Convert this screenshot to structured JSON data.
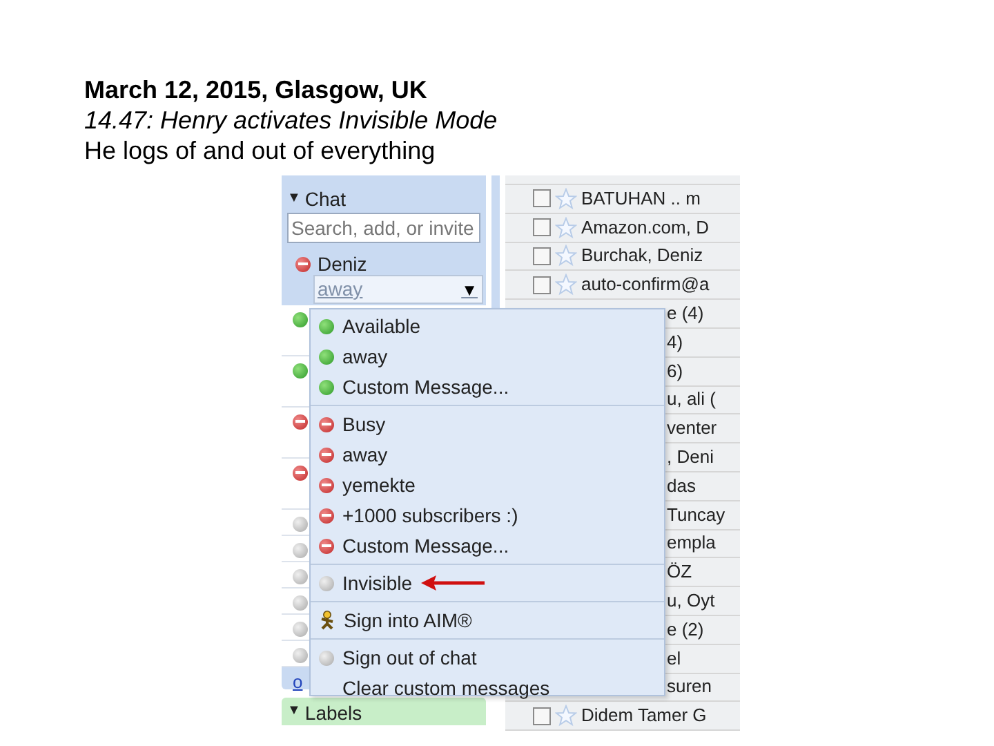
{
  "caption": {
    "heading": "March 12, 2015, Glasgow, UK",
    "subheading": "14.47: Henry activates Invisible Mode",
    "line": "He logs of and out of everything"
  },
  "chat": {
    "caret": "▼",
    "dropdown_caret": "▼",
    "title": "Chat",
    "expanded": true,
    "search_placeholder": "Search, add, or invite",
    "me": {
      "name": "Deniz",
      "kind": "busy",
      "status": "away"
    },
    "contacts": [
      {
        "kind": "available"
      },
      {
        "kind": "available"
      },
      {
        "kind": "busy"
      },
      {
        "kind": "busy"
      },
      {
        "kind": "idle"
      },
      {
        "kind": "idle"
      },
      {
        "kind": "idle"
      },
      {
        "kind": "idle"
      },
      {
        "kind": "idle"
      },
      {
        "kind": "idle"
      }
    ],
    "link": "o"
  },
  "labels": {
    "caret": "▼",
    "title": "Labels",
    "expanded": true
  },
  "status_menu": [
    [
      {
        "kind": "available",
        "label": "Available",
        "arrow": false
      },
      {
        "kind": "available",
        "label": "away",
        "arrow": false
      },
      {
        "kind": "available",
        "label": "Custom Message...",
        "arrow": false
      }
    ],
    [
      {
        "kind": "busy",
        "label": "Busy",
        "arrow": false
      },
      {
        "kind": "busy",
        "label": "away",
        "arrow": false
      },
      {
        "kind": "busy",
        "label": "yemekte",
        "arrow": false
      },
      {
        "kind": "busy",
        "label": "+1000 subscribers :)",
        "arrow": false
      },
      {
        "kind": "busy",
        "label": "Custom Message...",
        "arrow": false
      }
    ],
    [
      {
        "kind": "idle",
        "label": "Invisible",
        "arrow": true
      }
    ],
    [
      {
        "kind": "aim",
        "label": "Sign into AIM®",
        "arrow": false
      }
    ],
    [
      {
        "kind": "idle",
        "label": "Sign out of chat",
        "arrow": false
      },
      {
        "kind": "none",
        "label": "Clear custom messages",
        "arrow": false
      }
    ]
  ],
  "mail_rows": [
    {
      "kind": "full",
      "sender": "BATUHAN .. m",
      "checked": false
    },
    {
      "kind": "full",
      "sender": "Amazon.com, D",
      "checked": false
    },
    {
      "kind": "full",
      "sender": "Burchak, Deniz",
      "checked": false
    },
    {
      "kind": "full",
      "sender": "auto-confirm@a",
      "checked": false
    },
    {
      "kind": "covered",
      "sender": "e (4)"
    },
    {
      "kind": "covered",
      "sender": "4)"
    },
    {
      "kind": "covered",
      "sender": "6)"
    },
    {
      "kind": "covered",
      "sender": "u, ali ("
    },
    {
      "kind": "covered",
      "sender": "venter"
    },
    {
      "kind": "covered",
      "sender": ", Deni"
    },
    {
      "kind": "covered",
      "sender": "das"
    },
    {
      "kind": "covered",
      "sender": "Tuncay"
    },
    {
      "kind": "covered",
      "sender": "empla"
    },
    {
      "kind": "covered",
      "sender": "ÖZ"
    },
    {
      "kind": "covered",
      "sender": "u, Oyt"
    },
    {
      "kind": "covered",
      "sender": "e (2)"
    },
    {
      "kind": "covered",
      "sender": "el"
    },
    {
      "kind": "covered",
      "sender": "suren"
    },
    {
      "kind": "full",
      "sender": "Didem Tamer G",
      "checked": false
    }
  ]
}
